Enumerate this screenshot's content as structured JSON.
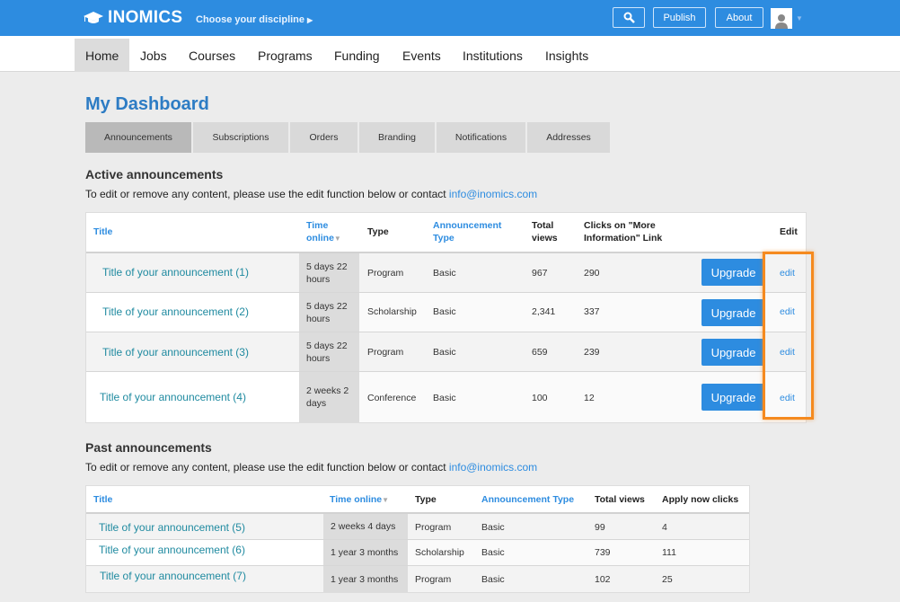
{
  "topbar": {
    "logo": "INOMICS",
    "discipline": "Choose your discipline",
    "buttons": {
      "search": "search",
      "publish": "Publish",
      "about": "About"
    },
    "brand_color": "#2d8ce0"
  },
  "nav": {
    "items": [
      "Home",
      "Jobs",
      "Courses",
      "Programs",
      "Funding",
      "Events",
      "Institutions",
      "Insights"
    ],
    "active": "Home"
  },
  "page": {
    "title": "My Dashboard",
    "tabs": [
      "Announcements",
      "Subscriptions",
      "Orders",
      "Branding",
      "Notifications",
      "Addresses"
    ],
    "active_tab": "Announcements"
  },
  "active": {
    "heading": "Active announcements",
    "note": "To edit or remove any content, please use the edit function below or contact ",
    "email": "info@inomics.com",
    "headers": {
      "title": "Title",
      "time": "Time online",
      "type": "Type",
      "atype": "Announcement Type",
      "views": "Total views",
      "clicks": "Clicks on \"More Information\" Link",
      "edit": "Edit"
    },
    "rows": [
      {
        "title": "Title of your announcement (1)",
        "time": "5 days 22 hours",
        "type": "Program",
        "atype": "Basic",
        "views": "967",
        "clicks": "290",
        "upgrade": "Upgrade",
        "edit": "edit"
      },
      {
        "title": "Title of your announcement (2)",
        "time": "5 days 22 hours",
        "type": "Scholarship",
        "atype": "Basic",
        "views": "2,341",
        "clicks": "337",
        "upgrade": "Upgrade",
        "edit": "edit"
      },
      {
        "title": "Title of your announcement (3)",
        "time": "5 days 22 hours",
        "type": "Program",
        "atype": "Basic",
        "views": "659",
        "clicks": "239",
        "upgrade": "Upgrade",
        "edit": "edit"
      },
      {
        "title": "Title of your announcement (4)",
        "time": "2 weeks 2 days",
        "type": "Conference",
        "atype": "Basic",
        "views": "100",
        "clicks": "12",
        "upgrade": "Upgrade",
        "edit": "edit"
      }
    ]
  },
  "past": {
    "heading": "Past announcements",
    "note": "To edit or remove any content, please use the edit function below or contact ",
    "email": "info@inomics.com",
    "headers": {
      "title": "Title",
      "time": "Time online",
      "type": "Type",
      "atype": "Announcement Type",
      "views": "Total views",
      "clicks": "Apply now clicks"
    },
    "rows": [
      {
        "title": "Title of your announcement (5)",
        "time": "2 weeks 4 days",
        "type": "Program",
        "atype": "Basic",
        "views": "99",
        "clicks": "4"
      },
      {
        "title": "Title of your announcement (6)",
        "time": "1 year 3 months",
        "type": "Scholarship",
        "atype": "Basic",
        "views": "739",
        "clicks": "111"
      },
      {
        "title": "Title of your announcement (7)",
        "time": "1 year 3 months",
        "type": "Program",
        "atype": "Basic",
        "views": "102",
        "clicks": "25"
      }
    ]
  },
  "highlight_color": "#f58a1f"
}
